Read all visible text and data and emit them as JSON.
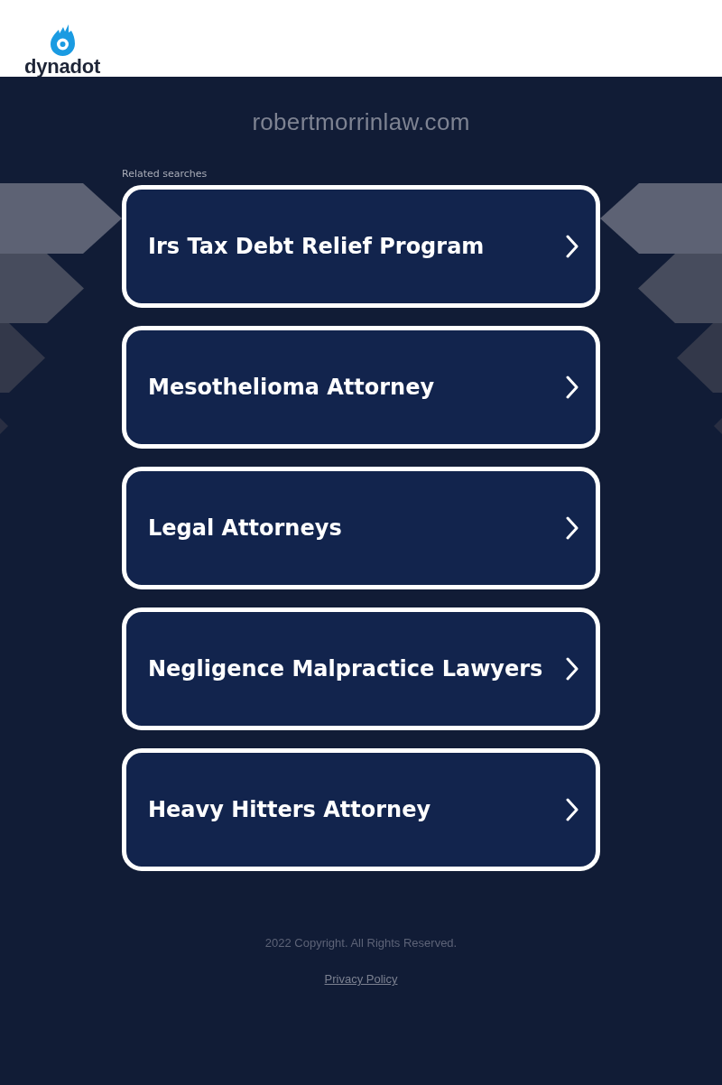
{
  "header": {
    "logo": {
      "text": "dynadot"
    }
  },
  "domain": "robertmorrinlaw.com",
  "related_searches": {
    "heading": "Related searches",
    "items": [
      {
        "label": "Irs Tax Debt Relief Program"
      },
      {
        "label": "Mesothelioma Attorney"
      },
      {
        "label": "Legal Attorneys"
      },
      {
        "label": "Negligence Malpractice Lawyers"
      },
      {
        "label": "Heavy Hitters Attorney"
      }
    ]
  },
  "footer": {
    "copyright": "2022 Copyright. All Rights Reserved.",
    "privacy_link": "Privacy Policy"
  }
}
